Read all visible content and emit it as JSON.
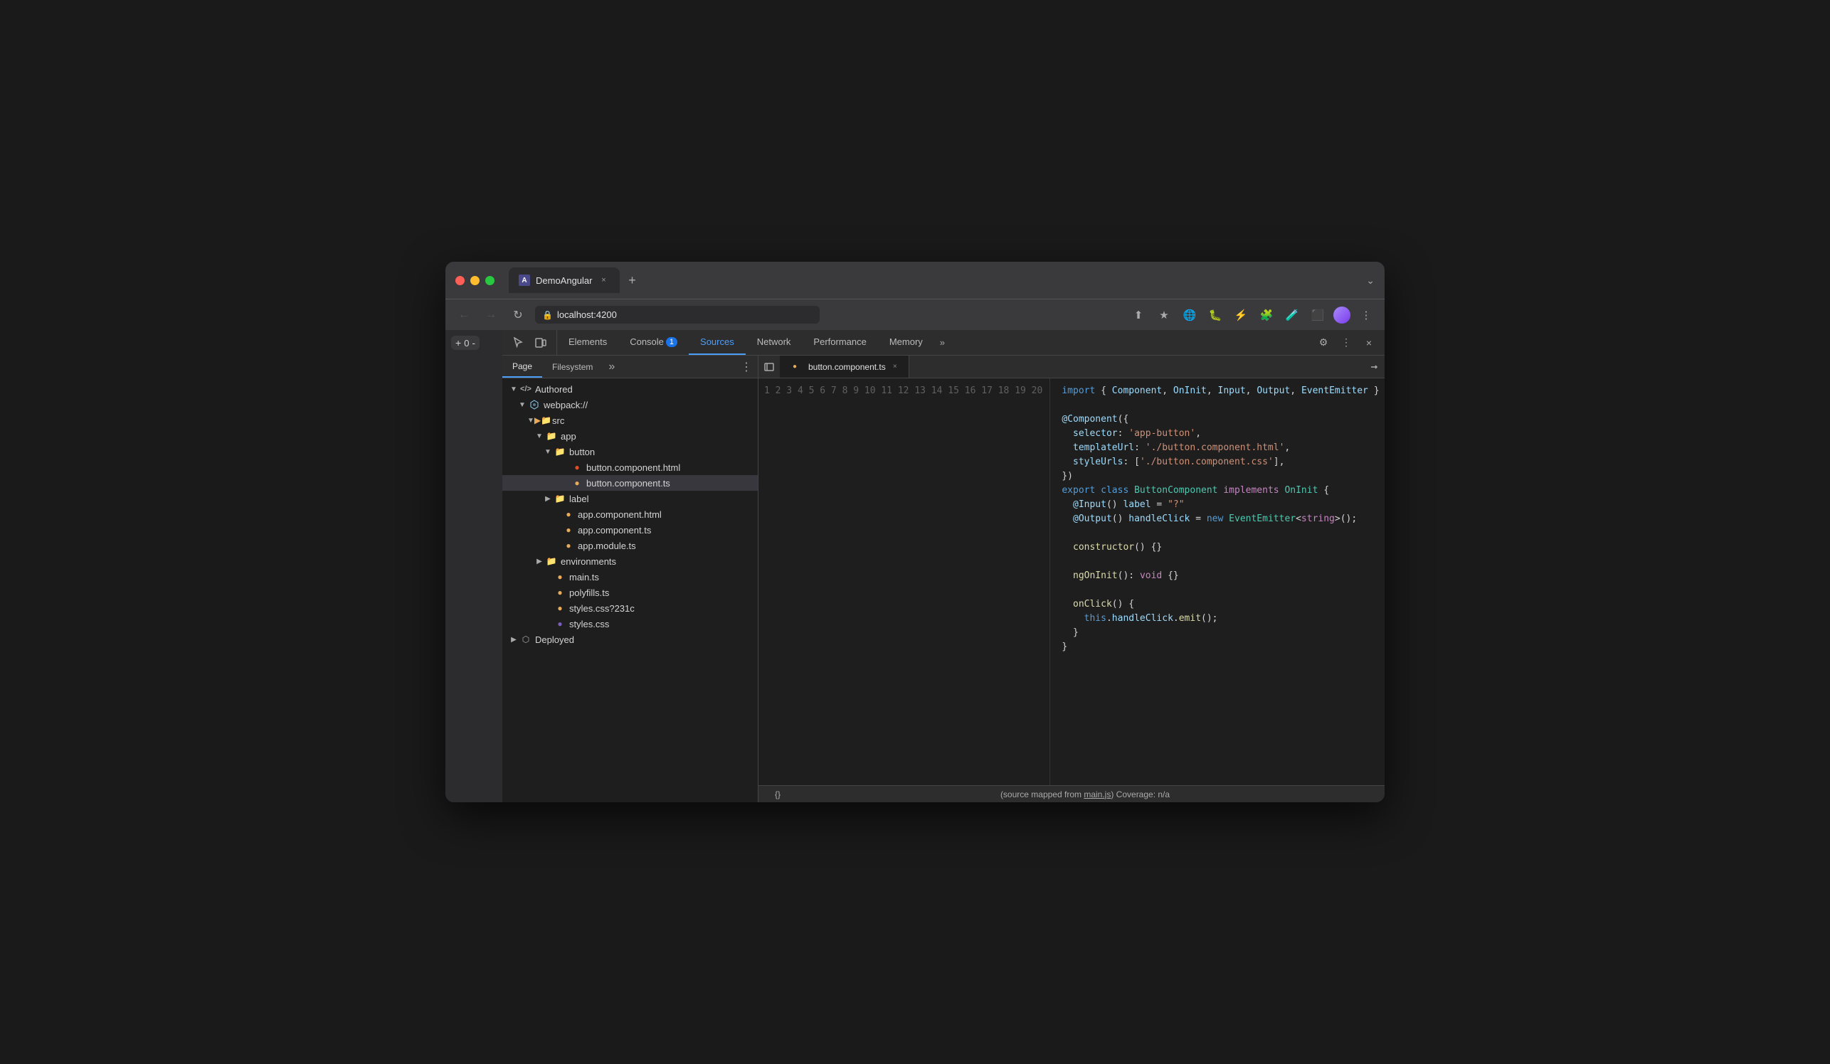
{
  "browser": {
    "tab_title": "DemoAngular",
    "tab_favicon": "A",
    "close_tab_label": "×",
    "new_tab_label": "+",
    "chevron_down_label": "⌄",
    "nav": {
      "back_label": "←",
      "forward_label": "→",
      "refresh_label": "↻",
      "address": "localhost:4200",
      "lock_icon": "🔒"
    },
    "toolbar_icons": [
      "⬆",
      "★",
      "🌐",
      "🐛",
      "⚡",
      "🧩",
      "🪄",
      "⬛",
      "👤",
      "⋮"
    ]
  },
  "devtools": {
    "tabs": [
      {
        "id": "elements",
        "label": "Elements",
        "active": false
      },
      {
        "id": "console",
        "label": "Console",
        "active": false
      },
      {
        "id": "sources",
        "label": "Sources",
        "active": true
      },
      {
        "id": "network",
        "label": "Network",
        "active": false
      },
      {
        "id": "performance",
        "label": "Performance",
        "active": false
      },
      {
        "id": "memory",
        "label": "Memory",
        "active": false
      }
    ],
    "tabs_more": "»",
    "console_badge": "1",
    "right_icons": [
      "⚙",
      "⋮",
      "×"
    ]
  },
  "sources_panel": {
    "sub_tabs": [
      {
        "id": "page",
        "label": "Page",
        "active": true
      },
      {
        "id": "filesystem",
        "label": "Filesystem",
        "active": false
      }
    ],
    "sub_tabs_more": "»",
    "menu_icon": "⋮",
    "file_tree": [
      {
        "id": "authored",
        "type": "folder",
        "label": "Authored",
        "indent": 0,
        "expanded": true,
        "icon": "</>"
      },
      {
        "id": "webpack",
        "type": "folder",
        "label": "webpack://",
        "indent": 1,
        "expanded": true,
        "icon": "cloud"
      },
      {
        "id": "src",
        "type": "folder",
        "label": "src",
        "indent": 2,
        "expanded": true,
        "icon": "folder"
      },
      {
        "id": "app",
        "type": "folder",
        "label": "app",
        "indent": 3,
        "expanded": true,
        "icon": "folder"
      },
      {
        "id": "button",
        "type": "folder",
        "label": "button",
        "indent": 4,
        "expanded": true,
        "icon": "folder"
      },
      {
        "id": "button_html",
        "type": "file",
        "label": "button.component.html",
        "indent": 5,
        "icon": "html"
      },
      {
        "id": "button_ts",
        "type": "file",
        "label": "button.component.ts",
        "indent": 5,
        "icon": "ts",
        "selected": true
      },
      {
        "id": "label",
        "type": "folder",
        "label": "label",
        "indent": 4,
        "expanded": false,
        "icon": "folder"
      },
      {
        "id": "app_html",
        "type": "file",
        "label": "app.component.html",
        "indent": 4,
        "icon": "html"
      },
      {
        "id": "app_ts",
        "type": "file",
        "label": "app.component.ts",
        "indent": 4,
        "icon": "ts"
      },
      {
        "id": "app_module",
        "type": "file",
        "label": "app.module.ts",
        "indent": 4,
        "icon": "ts"
      },
      {
        "id": "environments",
        "type": "folder",
        "label": "environments",
        "indent": 3,
        "expanded": false,
        "icon": "folder"
      },
      {
        "id": "main_ts",
        "type": "file",
        "label": "main.ts",
        "indent": 3,
        "icon": "ts"
      },
      {
        "id": "polyfills",
        "type": "file",
        "label": "polyfills.ts",
        "indent": 3,
        "icon": "ts"
      },
      {
        "id": "styles_css231c",
        "type": "file",
        "label": "styles.css?231c",
        "indent": 3,
        "icon": "css"
      },
      {
        "id": "styles_css",
        "type": "file",
        "label": "styles.css",
        "indent": 3,
        "icon": "css_purple"
      },
      {
        "id": "deployed",
        "type": "folder",
        "label": "Deployed",
        "indent": 0,
        "expanded": false,
        "icon": "deployed"
      }
    ],
    "editor_tab": {
      "filename": "button.component.ts",
      "close_label": "×"
    },
    "code_lines": [
      {
        "num": 1,
        "html": "<span class='kw'>import</span> <span class='pun'>{ </span><span class='dec'>Component</span><span class='pun'>, </span><span class='dec'>OnInit</span><span class='pun'>, </span><span class='dec'>Input</span><span class='pun'>, </span><span class='dec'>Output</span><span class='pun'>, </span><span class='dec'>EventEmitter</span><span class='pun'> }</span> <span class='kw2'>from</span> <span class='str'>'@a</span>"
      },
      {
        "num": 2,
        "html": ""
      },
      {
        "num": 3,
        "html": "<span class='dec'>@Component</span><span class='pun'>({</span>"
      },
      {
        "num": 4,
        "html": "  <span class='dec'>selector</span><span class='pun'>:</span> <span class='str'>'app-button'</span><span class='pun'>,</span>"
      },
      {
        "num": 5,
        "html": "  <span class='dec'>templateUrl</span><span class='pun'>:</span> <span class='str'>'./button.component.html'</span><span class='pun'>,</span>"
      },
      {
        "num": 6,
        "html": "  <span class='dec'>styleUrls</span><span class='pun'>: [</span><span class='str'>'./button.component.css'</span><span class='pun'>],</span>"
      },
      {
        "num": 7,
        "html": "<span class='pun'>})</span>"
      },
      {
        "num": 8,
        "html": "<span class='kw'>export</span> <span class='kw'>class</span> <span class='cls'>ButtonComponent</span> <span class='kw2'>implements</span> <span class='cls'>OnInit</span> <span class='pun'>{</span>"
      },
      {
        "num": 9,
        "html": "  <span class='dec'>@Input</span><span class='pun'>()</span> <span class='dec'>label</span> <span class='op'>=</span> <span class='str'>\"?\"</span>"
      },
      {
        "num": 10,
        "html": "  <span class='dec'>@Output</span><span class='pun'>()</span> <span class='dec'>handleClick</span> <span class='op'>=</span> <span class='kw'>new</span> <span class='cls'>EventEmitter</span><span class='pun'>&lt;</span><span class='kw2'>string</span><span class='pun'>&gt;();</span>"
      },
      {
        "num": 11,
        "html": ""
      },
      {
        "num": 12,
        "html": "  <span class='fn'>constructor</span><span class='pun'>() {}</span>"
      },
      {
        "num": 13,
        "html": ""
      },
      {
        "num": 14,
        "html": "  <span class='fn'>ngOnInit</span><span class='pun'>():</span> <span class='kw2'>void</span> <span class='pun'>{}</span>"
      },
      {
        "num": 15,
        "html": ""
      },
      {
        "num": 16,
        "html": "  <span class='fn'>onClick</span><span class='pun'>() {</span>"
      },
      {
        "num": 17,
        "html": "    <span class='kw'>this</span><span class='pun'>.</span><span class='dec'>handleClick</span><span class='pun'>.</span><span class='fn'>emit</span><span class='pun'>();</span>"
      },
      {
        "num": 18,
        "html": "  <span class='pun'>}</span>"
      },
      {
        "num": 19,
        "html": "<span class='pun'>}</span>"
      },
      {
        "num": 20,
        "html": ""
      }
    ],
    "status_bar": {
      "left_icon": "{}",
      "text": "(source mapped from ",
      "link": "main.js",
      "text2": ") Coverage: n/a"
    }
  },
  "zoom": {
    "decrease": "-",
    "value": "0",
    "increase": "+"
  }
}
